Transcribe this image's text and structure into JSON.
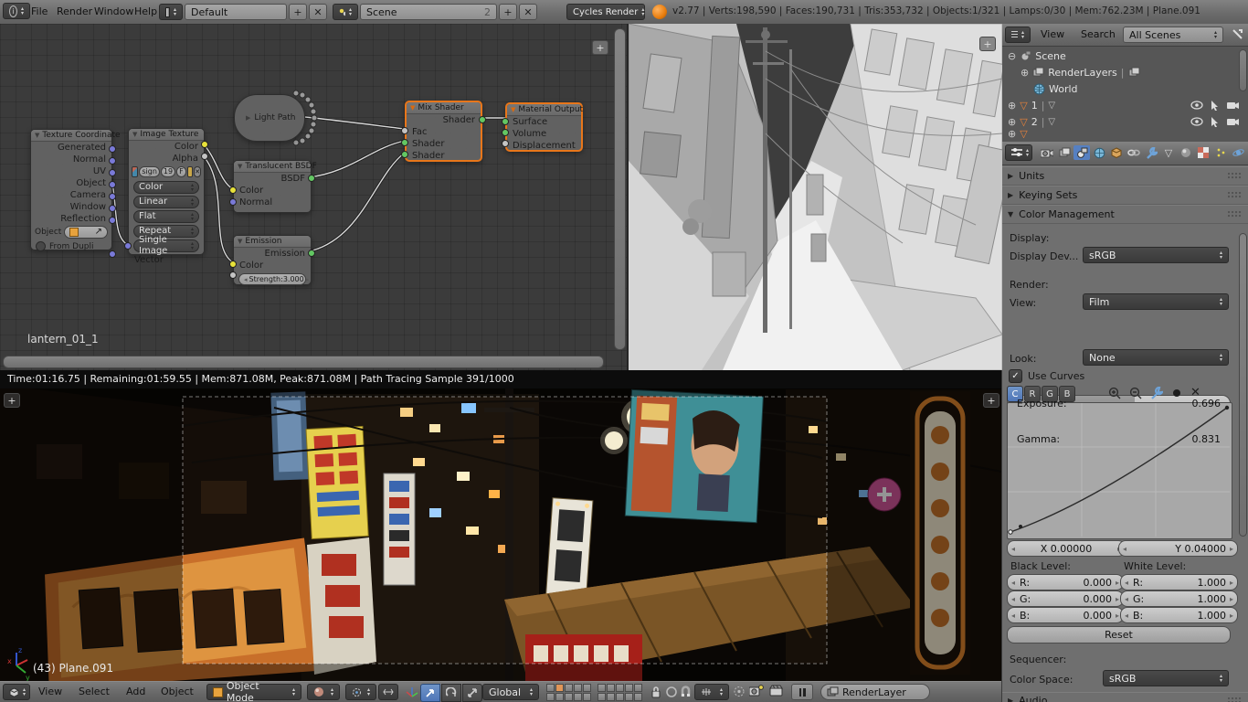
{
  "icons": {
    "tri_up": "▴",
    "tri_down": "▾",
    "tri_left": "◂",
    "tri_right": "▸",
    "expanded": "▼",
    "collapsed": "▶",
    "check": "✓",
    "close": "✕",
    "plus": "+",
    "circle_plus": "⊕",
    "circle_minus": "⊖",
    "pipe": "|",
    "info": "i"
  },
  "header": {
    "menus": [
      "File",
      "Render",
      "Window",
      "Help"
    ],
    "layout_value": "Default",
    "scene_value": "Scene",
    "scene_users": "2",
    "engine": "Cycles Render",
    "stats": "v2.77 | Verts:198,590 | Faces:190,731 | Tris:353,732 | Objects:1/321 | Lamps:0/30 | Mem:762.23M | Plane.091"
  },
  "node_editor": {
    "material_name": "lantern_01_1",
    "texture_coordinate": {
      "title": "Texture Coordinate",
      "outputs": [
        "Generated",
        "Normal",
        "UV",
        "Object",
        "Camera",
        "Window",
        "Reflection"
      ],
      "object_label": "Object",
      "from_dupli_label": "From Dupli"
    },
    "image_texture": {
      "title": "Image Texture",
      "outputs": [
        "Color",
        "Alpha"
      ],
      "image_name": "sign",
      "users": "19",
      "fake_user": "F",
      "fields": [
        "Color",
        "Linear",
        "Flat",
        "Repeat",
        "Single Image"
      ],
      "input": "Vector"
    },
    "light_path": {
      "title": "Light Path"
    },
    "translucent": {
      "title": "Translucent BSDF",
      "output": "BSDF",
      "inputs": [
        "Color",
        "Normal"
      ]
    },
    "emission": {
      "title": "Emission",
      "output": "Emission",
      "color_label": "Color",
      "strength_label": "Strength:",
      "strength_value": "3.000"
    },
    "mix_shader": {
      "title": "Mix Shader",
      "output": "Shader",
      "inputs": [
        "Fac",
        "Shader",
        "Shader"
      ]
    },
    "material_output": {
      "title": "Material Output",
      "inputs": [
        "Surface",
        "Volume",
        "Displacement"
      ]
    }
  },
  "outliner": {
    "menus": [
      "View",
      "Search"
    ],
    "filter_value": "All Scenes",
    "items": [
      "Scene",
      "RenderLayers",
      "World",
      "1",
      "2"
    ]
  },
  "properties": {
    "panels": {
      "units": "Units",
      "keying_sets": "Keying Sets",
      "color_management": "Color Management",
      "audio": "Audio"
    },
    "cm": {
      "display_label": "Display:",
      "device_label": "Display Dev...",
      "device_value": "sRGB",
      "render_label": "Render:",
      "view_label": "View:",
      "view_value": "Film",
      "exposure_label": "Exposure:",
      "exposure_value": "0.696",
      "gamma_label": "Gamma:",
      "gamma_value": "0.831",
      "look_label": "Look:",
      "look_value": "None",
      "use_curves_label": "Use Curves",
      "channels": [
        "C",
        "R",
        "G",
        "B"
      ],
      "x_value": "X 0.00000",
      "y_value": "Y 0.04000",
      "black_label": "Black Level:",
      "white_label": "White Level:",
      "r_label": "R:",
      "g_label": "G:",
      "b_label": "B:",
      "black": {
        "r": "0.000",
        "g": "0.000",
        "b": "0.000"
      },
      "white": {
        "r": "1.000",
        "g": "1.000",
        "b": "1.000"
      },
      "reset_label": "Reset",
      "sequencer_label": "Sequencer:",
      "color_space_label": "Color Space:",
      "color_space_value": "sRGB"
    }
  },
  "render_view": {
    "status": "Time:01:16.75 | Remaining:01:59.55 | Mem:871.08M, Peak:871.08M | Path Tracing Sample 391/1000",
    "object_label": "(43) Plane.091"
  },
  "toolbar": {
    "menus": [
      "View",
      "Select",
      "Add",
      "Object"
    ],
    "mode_value": "Object Mode",
    "orientation_value": "Global",
    "render_layer_value": "RenderLayer"
  }
}
